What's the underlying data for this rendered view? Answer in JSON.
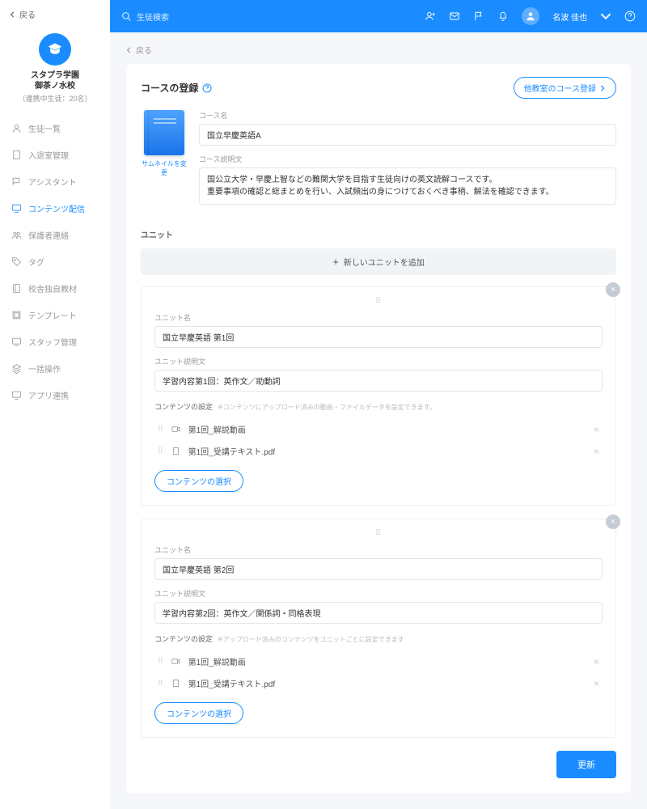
{
  "sidebar": {
    "back": "戻る",
    "school": {
      "name": "スタプラ学園\n御茶ノ水校",
      "sub": "（連携中生徒：20名）"
    },
    "nav": [
      {
        "label": "生徒一覧",
        "icon": "user"
      },
      {
        "label": "入退室管理",
        "icon": "door"
      },
      {
        "label": "アシスタント",
        "icon": "assistant"
      },
      {
        "label": "コンテンツ配信",
        "icon": "content",
        "active": true
      },
      {
        "label": "保護者連絡",
        "icon": "people"
      },
      {
        "label": "タグ",
        "icon": "tag"
      },
      {
        "label": "校舎独自教材",
        "icon": "book"
      },
      {
        "label": "テンプレート",
        "icon": "template"
      },
      {
        "label": "スタッフ管理",
        "icon": "staff"
      },
      {
        "label": "一括操作",
        "icon": "batch"
      },
      {
        "label": "アプリ連携",
        "icon": "app"
      }
    ]
  },
  "topbar": {
    "search_placeholder": "生徒検索",
    "username": "名波 佳也"
  },
  "content": {
    "back": "戻る",
    "title": "コースの登録",
    "other_room_btn": "他教室のコース登録",
    "thumbnail_link": "サムネイルを変更",
    "labels": {
      "course_name": "コース名",
      "course_desc": "コース説明文",
      "unit": "ユニット",
      "unit_name": "ユニット名",
      "unit_desc": "ユニット説明文",
      "content_setting": "コンテンツの設定",
      "add_unit": "新しいユニットを追加",
      "select_content": "コンテンツの選択",
      "update": "更新"
    },
    "hints": {
      "u1": "※コンテンツにアップロード済みの動画・ファイルデータを設定できます。",
      "u2": "※アップロード済みのコンテンツをユニットごとに設定できます"
    },
    "course": {
      "name": "国立早慶英語A",
      "desc": "国公立大学・早慶上智などの難関大学を目指す生徒向けの英文読解コースです。\n重要事項の確認と総まとめを行い、入試頻出の身につけておくべき事柄、解法を確認できます。"
    },
    "units": [
      {
        "name": "国立早慶英語 第1回",
        "desc": "学習内容第1回：英作文／助動詞",
        "contents": [
          {
            "type": "video",
            "name": "第1回_解説動画"
          },
          {
            "type": "file",
            "name": "第1回_受講テキスト.pdf"
          }
        ]
      },
      {
        "name": "国立早慶英語 第2回",
        "desc": "学習内容第2回：英作文／関係詞・同格表現",
        "contents": [
          {
            "type": "video",
            "name": "第1回_解説動画"
          },
          {
            "type": "file",
            "name": "第1回_受講テキスト.pdf"
          }
        ]
      }
    ]
  }
}
